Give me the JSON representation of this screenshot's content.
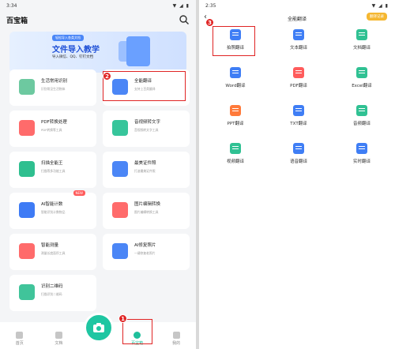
{
  "left": {
    "status_time": "3:34",
    "status_icons": "▼ ◢ ▮",
    "title": "百宝箱",
    "banner": {
      "sub": "轻松导入各类文档",
      "main": "文件导入教学",
      "desc": "导入微信、QQ、钉钉文档"
    },
    "cards": [
      {
        "name": "生活常用识别",
        "desc": "识别常见生活物体",
        "color": "#6dc9a0"
      },
      {
        "name": "全能翻译",
        "desc": "支持上百类翻译",
        "color": "#4b86f6"
      },
      {
        "name": "PDF转换处理",
        "desc": "PDF转换等工具",
        "color": "#ff6b6b"
      },
      {
        "name": "音视频转文字",
        "desc": "音视频转文字工具",
        "color": "#37c59b"
      },
      {
        "name": "扫描全能王",
        "desc": "扫描等多功能工具",
        "color": "#2fbf8f"
      },
      {
        "name": "最美证件照",
        "desc": "打造最美证件照",
        "color": "#4b86f6"
      },
      {
        "name": "AI智能计数",
        "desc": "智能识别计数物品",
        "color": "#3e7bf5"
      },
      {
        "name": "图片编辑转换",
        "desc": "图片编辑转换工具",
        "color": "#ff6b6b"
      },
      {
        "name": "智能测量",
        "desc": "测量长度面积工具",
        "color": "#ff6b6b"
      },
      {
        "name": "AI修复照片",
        "desc": "一键修复老照片",
        "color": "#4b86f6"
      },
      {
        "name": "识别二维码",
        "desc": "扫描识别二维码",
        "color": "#40c49a"
      }
    ],
    "new_badge": "NEW",
    "tabs": [
      {
        "label": "首页"
      },
      {
        "label": "文档"
      },
      {
        "label": ""
      },
      {
        "label": "百宝箱"
      },
      {
        "label": "我的"
      }
    ],
    "steps": {
      "one": "1",
      "two": "2"
    }
  },
  "right": {
    "status_time": "2:35",
    "status_icons": "▼ ◢ ▮",
    "title": "全能翻译",
    "vip": "翻译记录",
    "step_three": "3",
    "items": [
      {
        "label": "拍照翻译",
        "color": "#3f7ef5"
      },
      {
        "label": "文本翻译",
        "color": "#3f7ef5"
      },
      {
        "label": "文档翻译",
        "color": "#30c193"
      },
      {
        "label": "Word翻译",
        "color": "#3f7ef5"
      },
      {
        "label": "PDF翻译",
        "color": "#ff5c5c"
      },
      {
        "label": "Excel翻译",
        "color": "#30c193"
      },
      {
        "label": "PPT翻译",
        "color": "#ff7a3a"
      },
      {
        "label": "TXT翻译",
        "color": "#3f7ef5"
      },
      {
        "label": "音频翻译",
        "color": "#30c193"
      },
      {
        "label": "视频翻译",
        "color": "#30c193"
      },
      {
        "label": "语音翻译",
        "color": "#3f7ef5"
      },
      {
        "label": "实时翻译",
        "color": "#3f7ef5"
      }
    ]
  }
}
